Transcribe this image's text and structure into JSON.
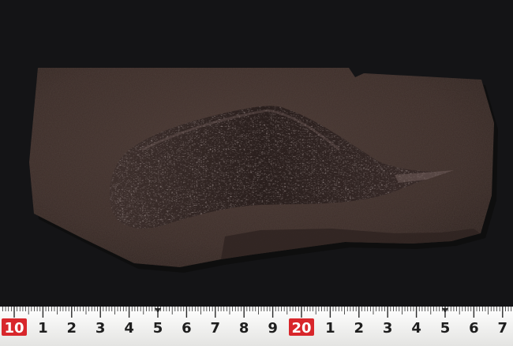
{
  "scene": {
    "subject": "fossil-slab",
    "background_color": "#141416",
    "slab_color": "#3d2e2a",
    "fossil_color": "#5a4a48"
  },
  "ruler": {
    "tape_color": "#f2f2f0",
    "accent_color": "#d8262b",
    "labels": [
      "10",
      "1",
      "2",
      "3",
      "4",
      "5",
      "6",
      "7",
      "8",
      "9",
      "20",
      "1",
      "2",
      "3",
      "4",
      "5",
      "6",
      "7"
    ],
    "highlighted": [
      0,
      10
    ]
  }
}
